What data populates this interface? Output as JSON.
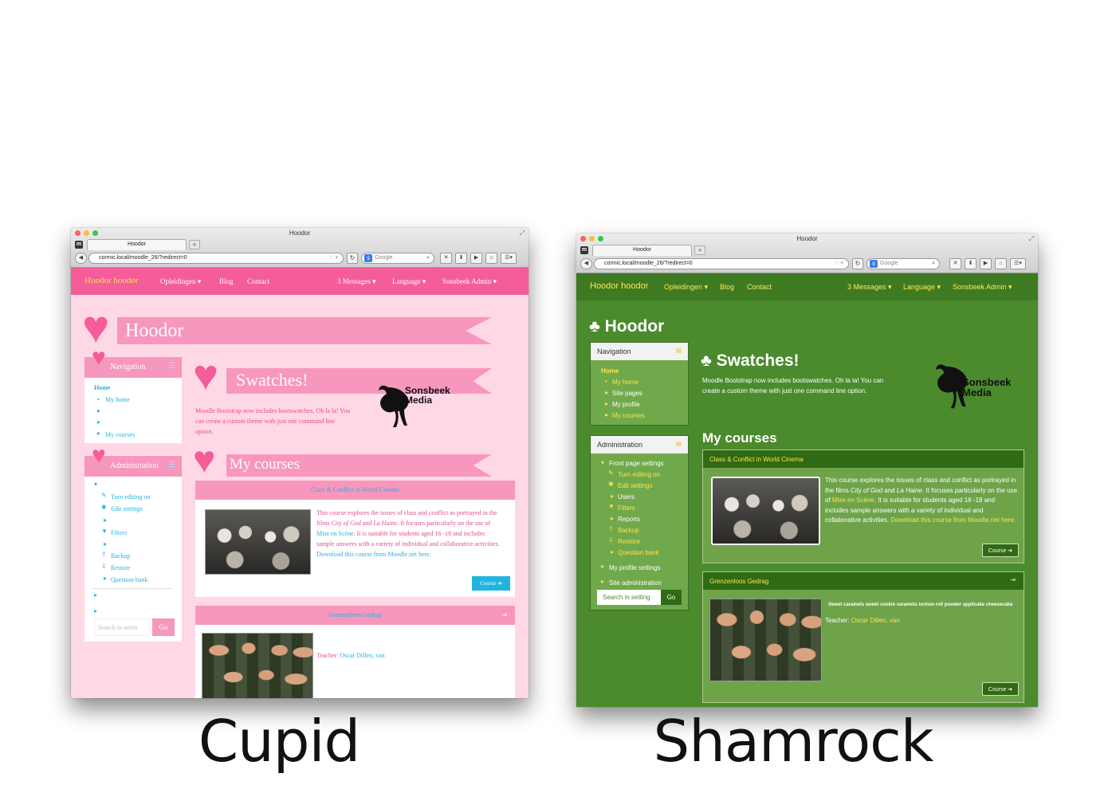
{
  "browser": {
    "window_title": "Hoodor",
    "tab_label": "Hoodor",
    "url": "cormic.local/moodle_26/?redirect=0",
    "search_placeholder": "Google"
  },
  "site": {
    "brand": "Hoodor hoodor",
    "nav_left": [
      "Opleidingen ▾",
      "Blog",
      "Contact"
    ],
    "nav_right": [
      "3 Messages ▾",
      "Language ▾",
      "Sonsbeek Admin ▾"
    ],
    "page_heading": "Hoodor",
    "swatches_title": "Swatches!",
    "swatches_text": "Moodle Bootstrap now includes bootswatches. Oh la la! You can create a custom theme with just one command line option.",
    "logo_text": [
      "Sonsbeek",
      "Media"
    ],
    "my_courses": "My courses",
    "search_placeholder": "Search in settings",
    "go_button": "Go",
    "course_button": "Course ➔",
    "courses": [
      {
        "title": "Class & Conflict in World Cinema",
        "desc_1": "This course explores the issues of class and conflict as portrayed in the films",
        "film_1": "City of God",
        "and": "and",
        "film_2": "La Haine",
        "desc_2": ". It focuses particularly on the use of",
        "link_1": "Mise en Scène",
        "desc_3": ". It is suitable for students aged 16 -18 and includes sample answers with a variety of individual and collaborative activities.",
        "link_2": "Download this course from Moodle.net here."
      },
      {
        "title": "Grenzenloos Gedrag",
        "summary": "Sweet caramels sweet cookie caramels tootsie roll powder applicake cheesecake",
        "teacher_label": "Teacher:",
        "teacher_name": "Oscar Dillen, van"
      }
    ]
  },
  "cupid": {
    "caption": "Cupid",
    "nav_block_title": "Navigation",
    "nav_items": [
      "Home",
      "My home",
      "My courses"
    ],
    "admin_block_title": "Administration",
    "admin_items": [
      "Turn editing on",
      "Edit settings",
      "Filters",
      "Backup",
      "Restore",
      "Question bank"
    ],
    "search_placeholder": "Search in settin",
    "colors": {
      "primary": "#f45c9a",
      "ribbon": "#f797bd",
      "background": "#ffd8e6",
      "link": "#23b3df"
    }
  },
  "shamrock": {
    "caption": "Shamrock",
    "nav_block_title": "Navigation",
    "nav_items": [
      "Home",
      "My home",
      "Site pages",
      "My profile",
      "My courses"
    ],
    "admin_block_title": "Administration",
    "admin_items": [
      "Front page settings",
      "Turn editing on",
      "Edit settings",
      "Users",
      "Filters",
      "Reports",
      "Backup",
      "Restore",
      "Question bank",
      "My profile settings",
      "Site administration"
    ],
    "search_placeholder": "Search in setting",
    "colors": {
      "primary": "#3e7a21",
      "background": "#4b8b2d",
      "block": "#70a94b",
      "link": "#ffe34a"
    }
  }
}
